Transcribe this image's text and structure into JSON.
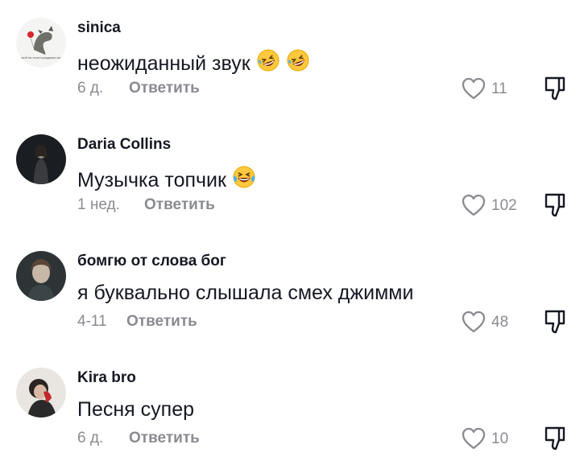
{
  "comments": [
    {
      "username": "sinica",
      "text": "неожиданный звук",
      "emoji": "rolling-laugh-emoji",
      "time": "6 д.",
      "reply": "Ответить",
      "likes": "11"
    },
    {
      "username": "Daria Collins",
      "text": "Музычка топчик",
      "emoji": "tears-of-joy-emoji",
      "time": "1 нед.",
      "reply": "Ответить",
      "likes": "102"
    },
    {
      "username": "бомгю от слова бог",
      "text": "я буквально слышала смех джимми",
      "time": "4-11",
      "reply": "Ответить",
      "likes": "48"
    },
    {
      "username": "Kira bro",
      "text": "Песня супер",
      "time": "6 д.",
      "reply": "Ответить",
      "likes": "10"
    }
  ],
  "avatar_caption": "я такой на этом празднике жизни",
  "colors": {
    "text": "#161823",
    "secondary": "#8a8b91",
    "emoji_yellow": "#FFC83D"
  }
}
